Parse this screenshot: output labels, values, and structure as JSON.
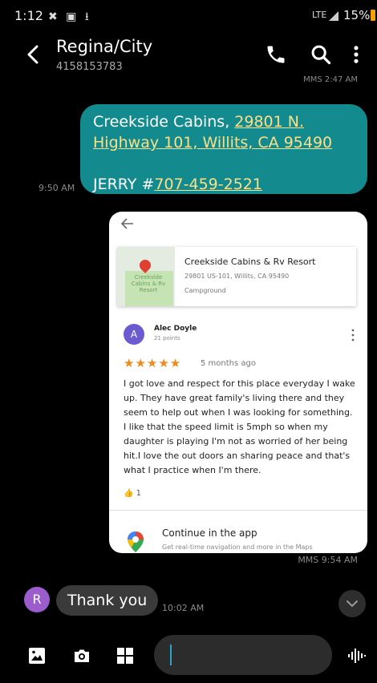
{
  "status_bar": {
    "time": "1:12",
    "network": "LTE",
    "battery": "15%"
  },
  "header": {
    "contact_name": "Regina/City",
    "contact_number": "4158153783",
    "cut_off_time": "MMS 2:47 AM"
  },
  "sent_message": {
    "line1_text": "Creekside Cabins, ",
    "line1_link": "29801 N.",
    "line2_link": "Highway 101, Willits, CA 95490",
    "line3_prefix": "JERRY #",
    "line3_link": "707-459-2521",
    "time": "9:50 AM"
  },
  "mms_card": {
    "map_label": "Creekside Cabins & Rv Resort",
    "place_name": "Creekside Cabins & Rv Resort",
    "place_address": "29801 US-101, Willits, CA 95490",
    "place_type": "Campground",
    "reviewer_initial": "A",
    "reviewer_name": "Alec Doyle",
    "reviewer_points": "21 points",
    "stars": "★★★★★",
    "rating": 5,
    "review_age": "5 months ago",
    "review_text": "I got love and respect for this place everyday I wake up. They have great family's living there and they seem to help out when I was looking for something. I like that the speed limit is 5mph so when my daughter is playing I'm not as worried of her being hit.I love the out doors an sharing peace and that's what I practice when I'm there.",
    "like_count": "1",
    "continue_title": "Continue in the app",
    "continue_sub": "Get real-time navigation and more in the Maps",
    "time": "MMS 9:54 AM"
  },
  "received_message": {
    "avatar_initial": "R",
    "text": "Thank you",
    "time": "10:02 AM"
  },
  "colors": {
    "sent_bubble": "#138b8e",
    "link": "#f8e08a",
    "received_bubble": "#3a3a3a",
    "star": "#f08a1c",
    "avatar_r": "#9b5ccc",
    "avatar_a": "#6a5bd0"
  },
  "icons": [
    "back-arrow-icon",
    "phone-icon",
    "search-icon",
    "more-vert-icon",
    "gallery-icon",
    "camera-icon",
    "apps-icon",
    "voice-icon",
    "chevron-down-icon",
    "google-maps-icon"
  ]
}
